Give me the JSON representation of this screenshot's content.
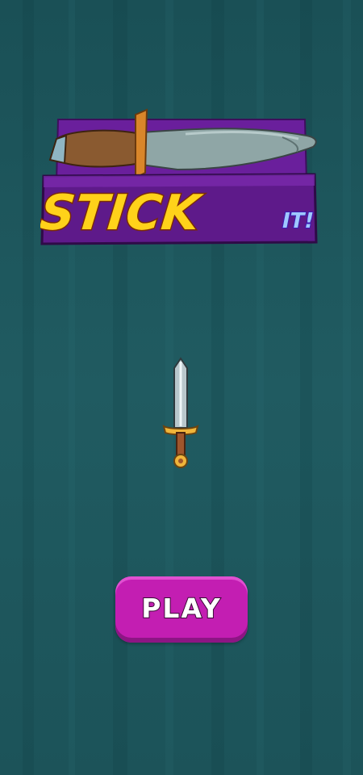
{
  "game": {
    "logo_main": "STICK",
    "logo_sub": "IT!"
  },
  "menu": {
    "play_label": "PLAY"
  },
  "colors": {
    "background": "#1f5a60",
    "play_button": "#c31eb2",
    "logo_panel": "#6a1f9c"
  },
  "icons": {
    "logo_knife": "knife-icon",
    "selected_weapon": "sword-icon"
  }
}
